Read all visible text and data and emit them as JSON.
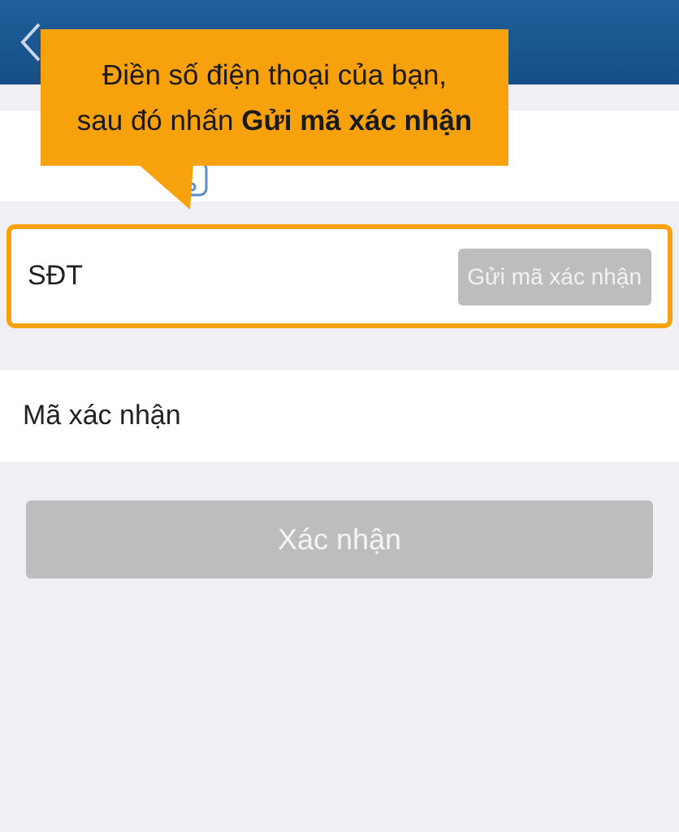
{
  "callout": {
    "text": "Điền số điện thoại của bạn, sau đó nhấn **Gửi mã xác nhận**"
  },
  "phone_field": {
    "placeholder": "SĐT",
    "highlighted": true,
    "send_button": {
      "label": "Gửi mã xác nhận",
      "disabled": true
    }
  },
  "code_field": {
    "placeholder": "Mã xác nhận"
  },
  "confirm_button": {
    "label": "Xác nhận",
    "disabled": true
  }
}
